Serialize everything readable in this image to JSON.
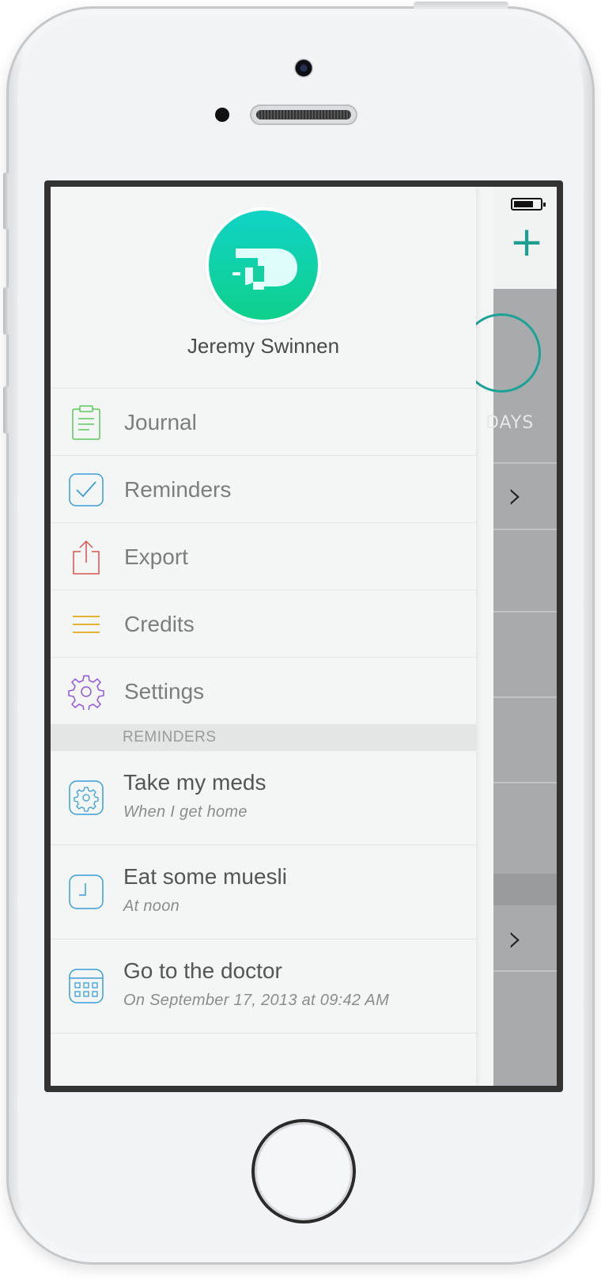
{
  "profile": {
    "name": "Jeremy Swinnen"
  },
  "menu": {
    "items": [
      {
        "label": "Journal",
        "icon": "clipboard-icon",
        "color": "#5cc85f"
      },
      {
        "label": "Reminders",
        "icon": "checkbox-icon",
        "color": "#3a9fd8"
      },
      {
        "label": "Export",
        "icon": "share-icon",
        "color": "#d9534f"
      },
      {
        "label": "Credits",
        "icon": "list-icon",
        "color": "#e5a81b"
      },
      {
        "label": "Settings",
        "icon": "gear-icon",
        "color": "#8f59d9"
      }
    ]
  },
  "reminders_section": {
    "header": "REMINDERS",
    "items": [
      {
        "title": "Take my meds",
        "subtitle": "When I get home",
        "icon": "gear-icon"
      },
      {
        "title": "Eat some muesli",
        "subtitle": "At noon",
        "icon": "clock-icon"
      },
      {
        "title": "Go to the doctor",
        "subtitle": "On September 17, 2013 at 09:42 AM",
        "icon": "calendar-icon"
      }
    ]
  },
  "background_app": {
    "days_label": "DAYS",
    "accent_color": "#1aa396"
  }
}
